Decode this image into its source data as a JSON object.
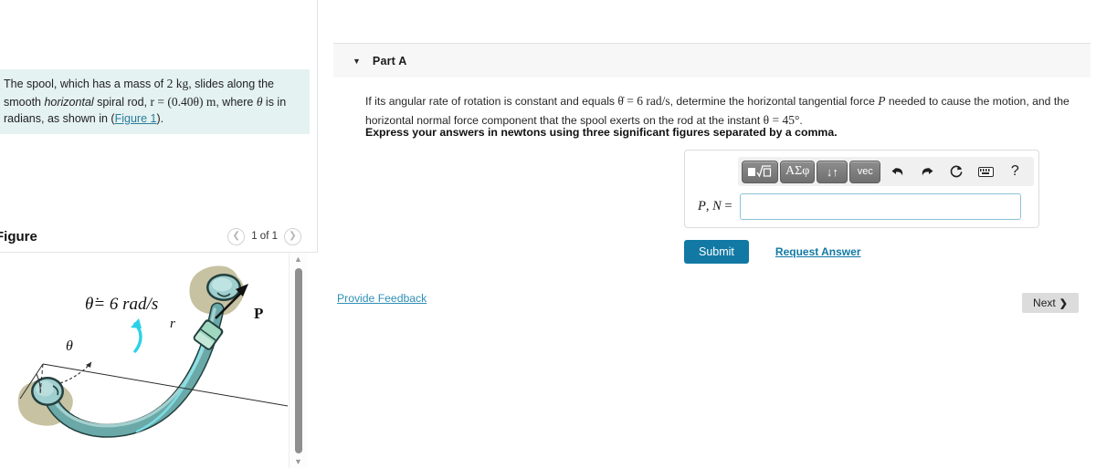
{
  "left_panel": {
    "problem": {
      "line1_a": "The spool, which has a mass of ",
      "mass": "2 kg",
      "line1_b": ", slides along the smooth ",
      "horizontal_word": "horizontal",
      "line2_a": " spiral rod, ",
      "eq_r": "r = (0.40θ) m",
      "line2_b": ", where ",
      "theta": "θ",
      "line2_c": " is in radians, as shown in (",
      "figure_link": "Figure 1",
      "line2_d": ")."
    },
    "figure_header": {
      "title": "Figure",
      "count": "1 of 1",
      "prev_icon": "chevron-left-icon",
      "next_icon": "chevron-right-icon"
    },
    "figure": {
      "theta_dot_label": "θ̇= 6 rad/s",
      "r_label": "r",
      "theta_label": "θ",
      "force_label": "P",
      "rod_color": "#6aa9a7",
      "rod_highlight": "#a8d3d2",
      "base_color": "#c6c2a2",
      "collar_color": "#9fd8bf",
      "arrow_color": "#2ad2e8"
    },
    "scrollbar": {
      "up_icon": "triangle-up-icon",
      "down_icon": "triangle-down-icon"
    }
  },
  "right_panel": {
    "part": {
      "caret_icon": "triangle-down-icon",
      "label": "Part A"
    },
    "question": {
      "t1": "If its angular rate of rotation is constant and equals ",
      "eq1": "θ̇ = 6 rad/s",
      "t2": ", determine the horizontal tangential force ",
      "sym_p": "P",
      "t3": " needed to cause the motion, and the horizontal normal force component that the spool exerts on the rod at the instant ",
      "eq2": "θ = 45°",
      "t4": "."
    },
    "instruction": "Express your answers in newtons using three significant figures separated by a comma.",
    "toolbar": {
      "template_button": "template-sqrt-icon",
      "greek_button": "ΑΣφ",
      "supsub_button": "↓↑",
      "vector_button": "vec",
      "undo_icon": "undo-arrow-icon",
      "redo_icon": "redo-arrow-icon",
      "reset_icon": "reset-circle-icon",
      "keyboard_icon": "keyboard-icon",
      "help_label": "?"
    },
    "answer": {
      "label_p": "P",
      "label_comma": ", ",
      "label_n": "N",
      "label_eq": " =",
      "value": "",
      "placeholder": ""
    },
    "submit_label": "Submit",
    "request_answer_label": "Request Answer",
    "provide_feedback_label": "Provide Feedback",
    "next_label": "Next",
    "next_chevron": "❯"
  },
  "colors": {
    "problem_bg": "#e4f2f1",
    "submit_blue": "#1279a4",
    "link_blue": "#2f8fb5",
    "input_border": "#8cc3d6",
    "header_gray": "#f7f7f7",
    "next_gray": "#dcdcdc"
  }
}
